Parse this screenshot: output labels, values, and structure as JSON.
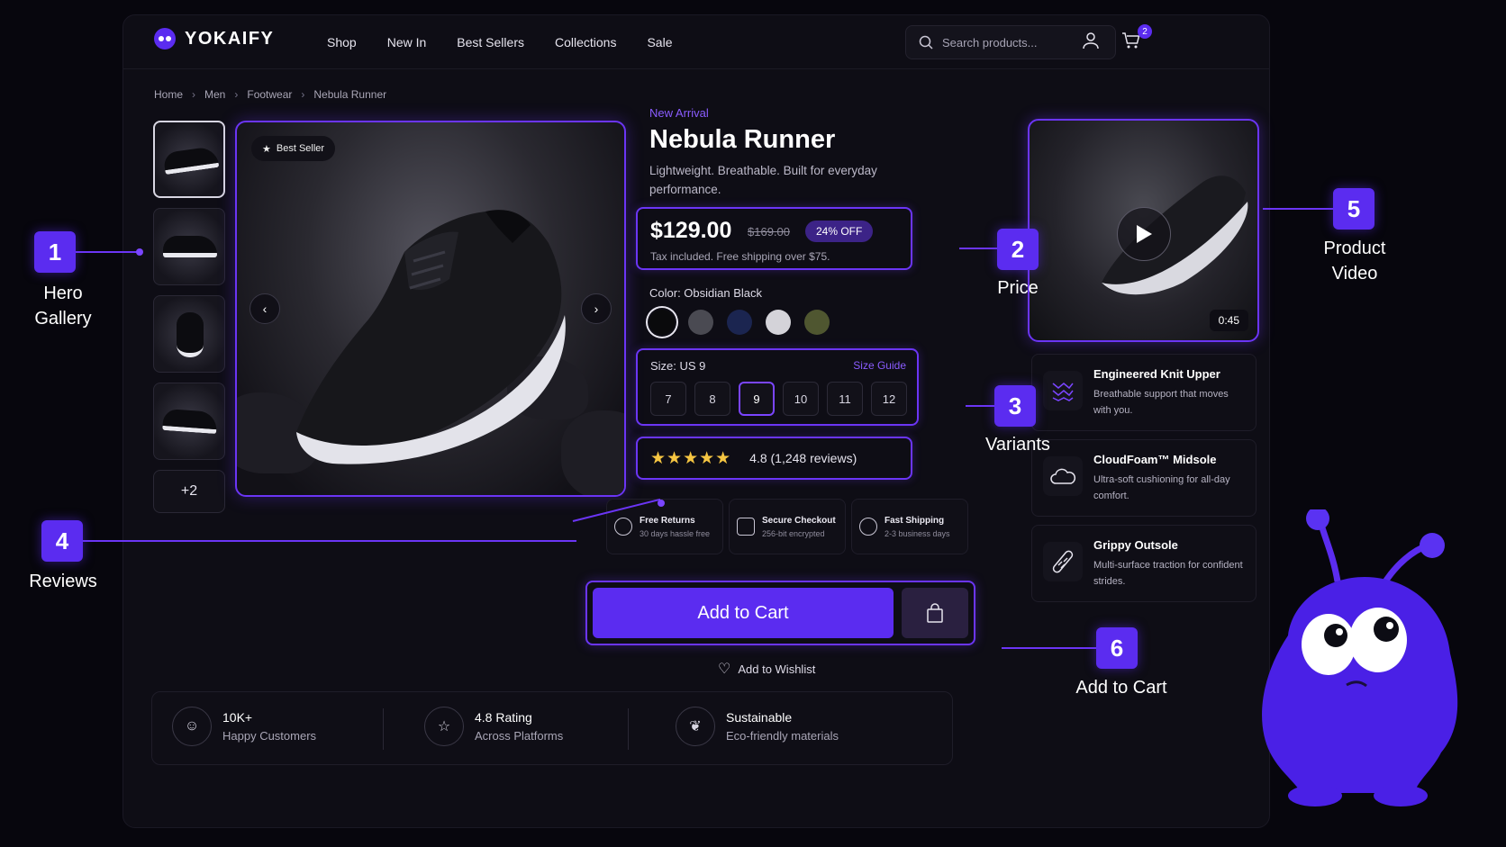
{
  "brand": {
    "name": "YOKAIFY"
  },
  "nav": [
    "Shop",
    "New In",
    "Best Sellers",
    "Collections",
    "Sale"
  ],
  "search": {
    "placeholder": "Search products..."
  },
  "cart": {
    "count": "2"
  },
  "breadcrumb": [
    "Home",
    "Men",
    "Footwear",
    "Nebula Runner"
  ],
  "gallery": {
    "more_label": "+2",
    "badge": "Best Seller"
  },
  "product": {
    "eyebrow": "New Arrival",
    "title": "Nebula Runner",
    "description": "Lightweight. Breathable. Built for everyday performance.",
    "price": "$129.00",
    "old_price": "$169.00",
    "discount": "24% OFF",
    "tax_note": "Tax included. Free shipping over $75.",
    "color_label": "Color: Obsidian Black",
    "colors": [
      "#0a0a0c",
      "#4a4a52",
      "#1b2550",
      "#d4d3d9",
      "#4f5630"
    ],
    "size_label": "Size: US 9",
    "size_guide": "Size Guide",
    "sizes": [
      "7",
      "8",
      "9",
      "10",
      "11",
      "12"
    ],
    "selected_size": "9",
    "stars": "★★★★★",
    "rating_text": "4.8 (1,248 reviews)"
  },
  "perks": [
    {
      "title": "Free Returns",
      "sub": "30 days hassle free"
    },
    {
      "title": "Secure Checkout",
      "sub": "256-bit encrypted"
    },
    {
      "title": "Fast Shipping",
      "sub": "2-3 business days"
    }
  ],
  "actions": {
    "add_to_cart": "Add to Cart",
    "wishlist": "Add to Wishlist"
  },
  "stats": [
    {
      "title": "10K+",
      "sub": "Happy Customers"
    },
    {
      "title": "4.8 Rating",
      "sub": "Across Platforms"
    },
    {
      "title": "Sustainable",
      "sub": "Eco-friendly materials"
    }
  ],
  "video": {
    "duration": "0:45"
  },
  "features": [
    {
      "title": "Engineered Knit Upper",
      "sub": "Breathable support that moves with you."
    },
    {
      "title": "CloudFoam™ Midsole",
      "sub": "Ultra-soft cushioning for all-day comfort."
    },
    {
      "title": "Grippy Outsole",
      "sub": "Multi-surface traction for confident strides."
    }
  ],
  "callouts": [
    {
      "num": "1",
      "label": "Hero Gallery"
    },
    {
      "num": "2",
      "label": "Price"
    },
    {
      "num": "3",
      "label": "Variants"
    },
    {
      "num": "4",
      "label": "Reviews"
    },
    {
      "num": "5",
      "label": "Product Video"
    },
    {
      "num": "6",
      "label": "Add to Cart"
    }
  ],
  "colors": {
    "accent": "#6b35f5",
    "button": "#5b2cf0",
    "link": "#8a5cff",
    "star": "#f5c542"
  }
}
